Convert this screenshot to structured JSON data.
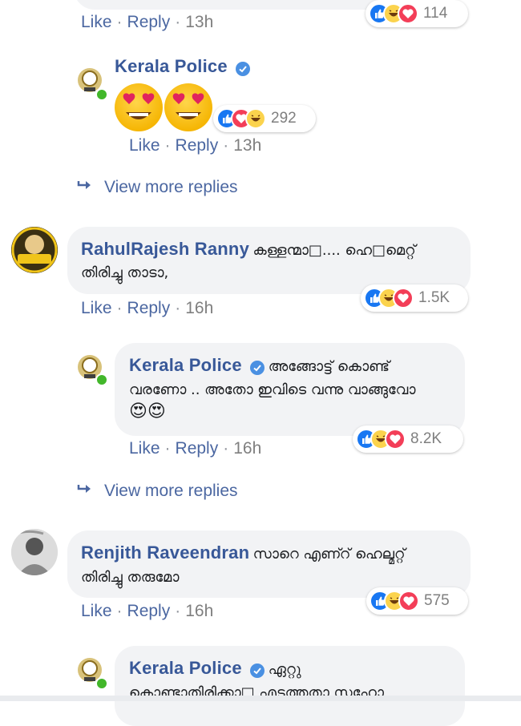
{
  "top": {
    "actions": {
      "like": "Like",
      "reply": "Reply",
      "time": "13h"
    },
    "reactions": {
      "count": "114",
      "types": [
        "like",
        "haha",
        "love"
      ]
    }
  },
  "reply1": {
    "author": "Kerala Police",
    "emoji_text": "😍😍",
    "actions": {
      "like": "Like",
      "reply": "Reply",
      "time": "13h"
    },
    "reactions": {
      "count": "292",
      "types": [
        "like",
        "love",
        "haha"
      ]
    }
  },
  "view_more_1": "View more replies",
  "comment2": {
    "author": "RahulRajesh Ranny",
    "text_line1": "കള്ളന്മാ□.... ഹെ□മെറ്റ്",
    "text_line2": "തിരിച്ചു താടാ,",
    "actions": {
      "like": "Like",
      "reply": "Reply",
      "time": "16h"
    },
    "reactions": {
      "count": "1.5K",
      "types": [
        "like",
        "haha",
        "love"
      ]
    }
  },
  "reply2": {
    "author": "Kerala Police",
    "text_line1": "അങ്ങോട്ട് കൊണ്ട്",
    "text_line2": "വരണോ .. അതോ ഇവിടെ വന്നു വാങ്ങുവോ",
    "text_line3": "😍😍",
    "actions": {
      "like": "Like",
      "reply": "Reply",
      "time": "16h"
    },
    "reactions": {
      "count": "8.2K",
      "types": [
        "like",
        "haha",
        "love"
      ]
    }
  },
  "view_more_2": "View more replies",
  "comment3": {
    "author": "Renjith Raveendran",
    "text_line1": "സാറെ എണ്റ് ഹെല്മറ്റ്",
    "text_line2": "തിരിച്ചു തരുമോ",
    "actions": {
      "like": "Like",
      "reply": "Reply",
      "time": "16h"
    },
    "reactions": {
      "count": "575",
      "types": [
        "like",
        "haha",
        "love"
      ]
    }
  },
  "reply3": {
    "author": "Kerala Police",
    "text_line1": "ഏറ്റു",
    "text_line2": "കൊണ്ടാതിരിക്കാ□ എടുത്തതാ സഹോ"
  },
  "colors": {
    "name_link": "#385898",
    "action_link": "#4b67a1",
    "bubble_bg": "#f2f3f5",
    "like_blue": "#1877f2",
    "love_red": "#f33e58",
    "haha_yellow": "#fbd34d",
    "online_green": "#42b72a"
  }
}
